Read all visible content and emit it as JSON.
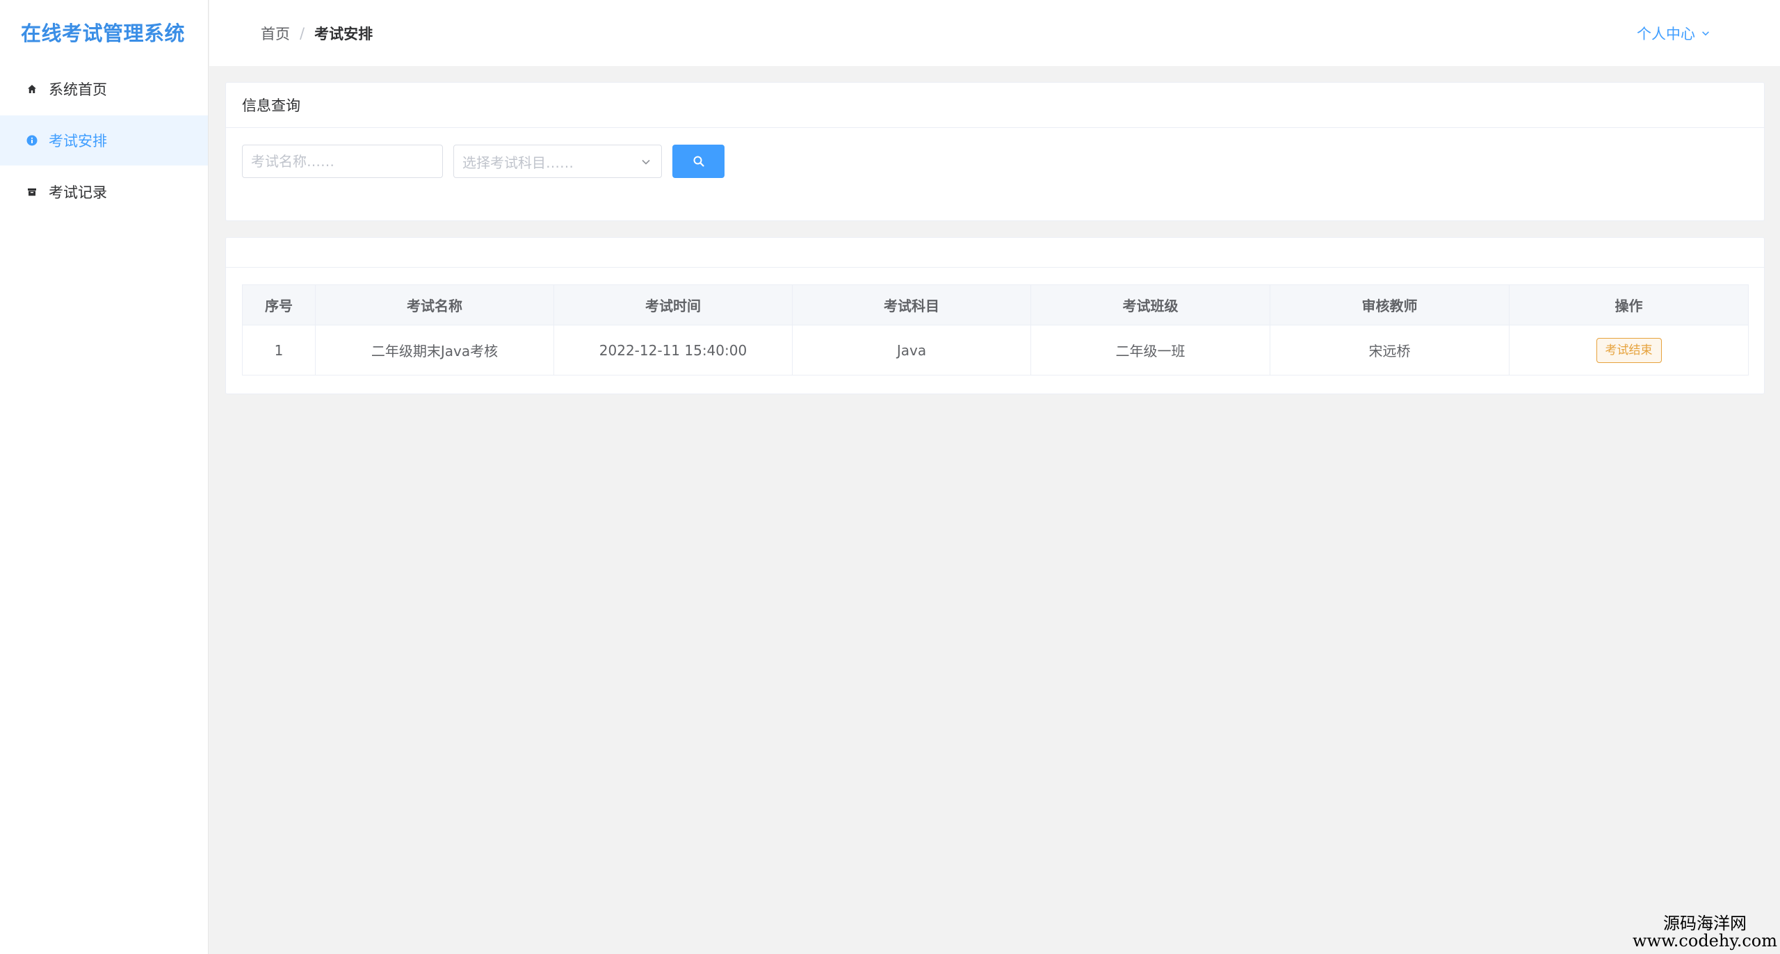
{
  "app": {
    "title": "在线考试管理系统"
  },
  "sidebar": {
    "items": [
      {
        "label": "系统首页",
        "icon": "home-icon",
        "active": false
      },
      {
        "label": "考试安排",
        "icon": "info-circle-icon",
        "active": true
      },
      {
        "label": "考试记录",
        "icon": "archive-icon",
        "active": false
      }
    ]
  },
  "header": {
    "breadcrumb": {
      "home": "首页",
      "separator": "/",
      "current": "考试安排"
    },
    "user_center": "个人中心"
  },
  "query": {
    "title": "信息查询",
    "name_placeholder": "考试名称……",
    "subject_placeholder": "选择考试科目……"
  },
  "table": {
    "columns": [
      "序号",
      "考试名称",
      "考试时间",
      "考试科目",
      "考试班级",
      "审核教师",
      "操作"
    ],
    "rows": [
      {
        "index": "1",
        "name": "二年级期末Java考核",
        "time": "2022-12-11 15:40:00",
        "subject": "Java",
        "class": "二年级一班",
        "teacher": "宋远桥",
        "action": "考试结束"
      }
    ]
  },
  "watermark": {
    "cn": "源码海洋网",
    "en": "www.codehy.com"
  },
  "colors": {
    "primary": "#409eff",
    "brand": "#3a8ee6",
    "warning": "#e6a23c",
    "background": "#f2f2f2"
  }
}
